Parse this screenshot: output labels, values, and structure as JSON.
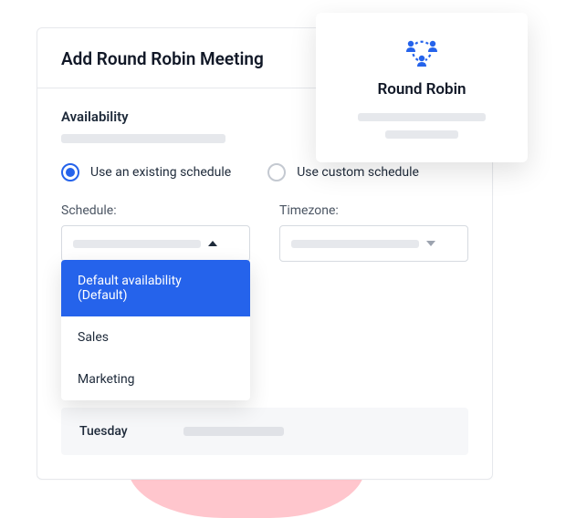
{
  "header": {
    "title": "Add Round Robin Meeting"
  },
  "availability": {
    "section_title": "Availability",
    "options": {
      "existing": "Use an existing schedule",
      "custom": "Use custom schedule"
    },
    "schedule_label": "Schedule:",
    "timezone_label": "Timezone:",
    "dropdown": {
      "items": [
        {
          "label": "Default availability (Default)",
          "selected": true
        },
        {
          "label": "Sales",
          "selected": false
        },
        {
          "label": "Marketing",
          "selected": false
        }
      ]
    },
    "days": {
      "tuesday": "Tuesday"
    }
  },
  "float": {
    "title": "Round Robin"
  }
}
